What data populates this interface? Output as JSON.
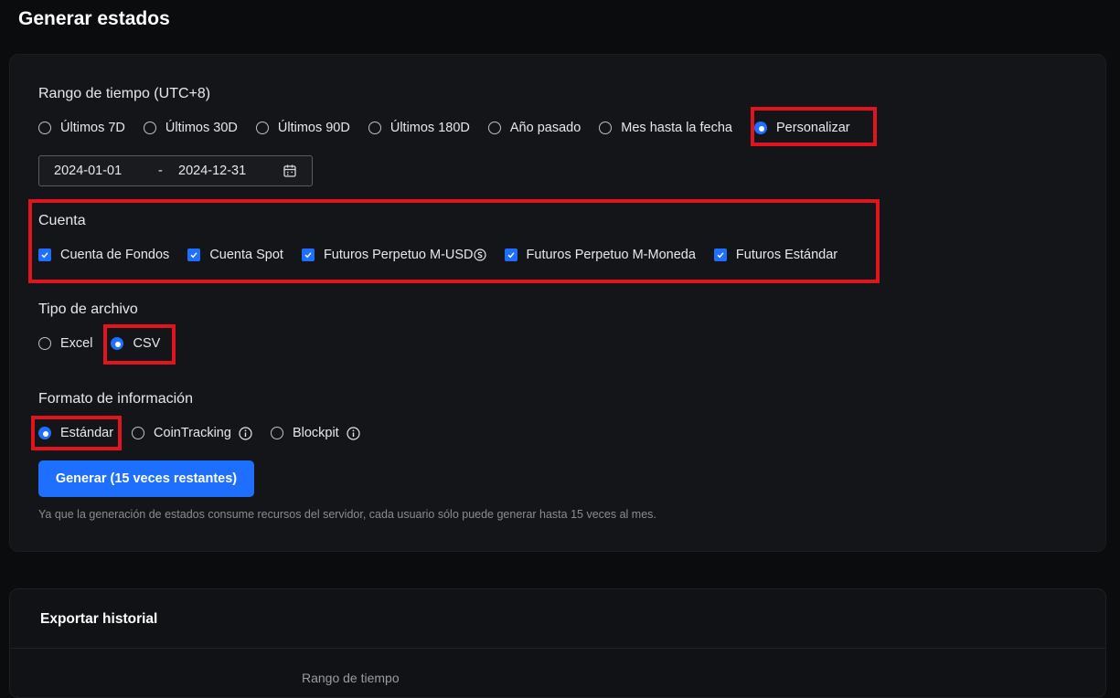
{
  "page": {
    "title": "Generar estados"
  },
  "time_range": {
    "label": "Rango de tiempo  (UTC+8)",
    "options": [
      {
        "label": "Últimos 7D",
        "selected": false
      },
      {
        "label": "Últimos 30D",
        "selected": false
      },
      {
        "label": "Últimos 90D",
        "selected": false
      },
      {
        "label": "Últimos 180D",
        "selected": false
      },
      {
        "label": "Año pasado",
        "selected": false
      },
      {
        "label": "Mes hasta la fecha",
        "selected": false
      },
      {
        "label": "Personalizar",
        "selected": true
      }
    ],
    "start_date": "2024-01-01",
    "separator": "-",
    "end_date": "2024-12-31"
  },
  "account": {
    "label": "Cuenta",
    "options": [
      {
        "label": "Cuenta de Fondos",
        "checked": true
      },
      {
        "label": "Cuenta Spot",
        "checked": true
      },
      {
        "label": "Futuros Perpetuo M-USD",
        "checked": true
      },
      {
        "label": "Futuros Perpetuo M-Moneda",
        "checked": true
      },
      {
        "label": "Futuros Estándar",
        "checked": true
      }
    ]
  },
  "file_type": {
    "label": "Tipo de archivo",
    "options": [
      {
        "label": "Excel",
        "selected": false
      },
      {
        "label": "CSV",
        "selected": true
      }
    ]
  },
  "info_format": {
    "label": "Formato de información",
    "options": [
      {
        "label": "Estándar",
        "selected": true
      },
      {
        "label": "CoinTracking",
        "selected": false
      },
      {
        "label": "Blockpit",
        "selected": false
      }
    ]
  },
  "generate_button": {
    "label": "Generar (15 veces restantes)"
  },
  "note": "Ya que la generación de estados consume recursos del servidor, cada usuario sólo puede generar hasta 15 veces al mes.",
  "export_history": {
    "title": "Exportar historial",
    "column_time_range": "Rango de tiempo"
  },
  "colors": {
    "accent": "#1f6fff",
    "highlight": "#e0141e",
    "background": "#0b0c0e",
    "card": "#141518"
  }
}
